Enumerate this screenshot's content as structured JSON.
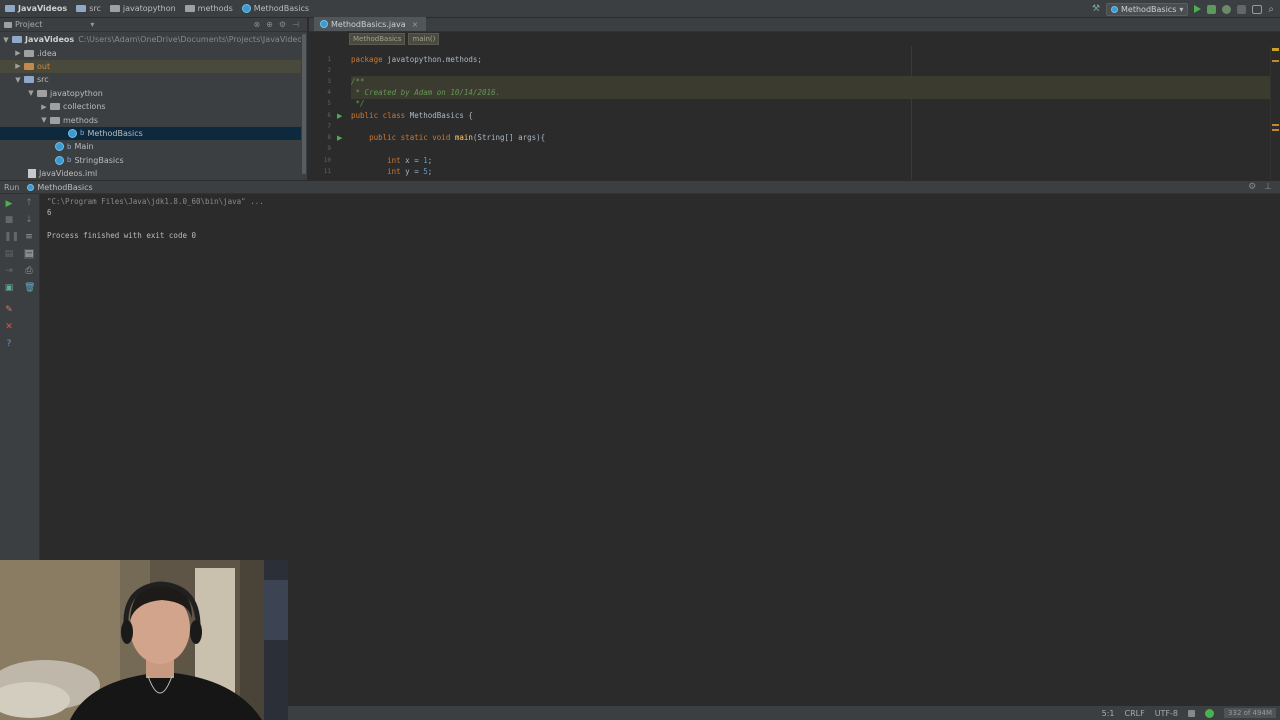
{
  "navbar": {
    "crumbs": [
      "JavaVideos",
      "src",
      "javatopython",
      "methods",
      "MethodBasics"
    ],
    "run_config": "MethodBasics"
  },
  "project": {
    "header": "Project",
    "root": {
      "label": "JavaVideos",
      "path": "C:\\Users\\Adam\\OneDrive\\Documents\\Projects\\JavaVideos"
    },
    "items": [
      {
        "label": ".idea"
      },
      {
        "label": "out"
      },
      {
        "label": "src"
      },
      {
        "label": "javatopython"
      },
      {
        "label": "collections"
      },
      {
        "label": "methods"
      },
      {
        "label": "MethodBasics"
      },
      {
        "label": "Main"
      },
      {
        "label": "StringBasics"
      },
      {
        "label": "JavaVideos.iml"
      }
    ]
  },
  "editor": {
    "tab": "MethodBasics.java",
    "crumbs": [
      "MethodBasics",
      "main()"
    ],
    "line_numbers": [
      "1",
      "2",
      "3",
      "4",
      "5",
      "6",
      "7",
      "8",
      "9",
      "10",
      "11"
    ],
    "code": {
      "l1_kw": "package",
      "l1_rest": " javatopython.methods;",
      "l3": "/**",
      "l4": " * Created by Adam on 10/14/2016.",
      "l5": " */",
      "l6_kw": "public class",
      "l6_rest": " MethodBasics {",
      "l8_kw": "public static void",
      "l8_fn": "main",
      "l8_rest": "(String[] args){",
      "l10_kw": "int",
      "l10_mid": " x = ",
      "l10_num": "1",
      "l11_kw": "int",
      "l11_mid": " y = ",
      "l11_num": "5"
    }
  },
  "run": {
    "label": "Run",
    "tab": "MethodBasics",
    "console": {
      "cmd": "\"C:\\Program Files\\Java\\jdk1.8.0_60\\bin\\java\" ...",
      "output": "6",
      "finished": "Process finished with exit code 0"
    }
  },
  "status": {
    "position": "5:1",
    "line_sep": "CRLF",
    "encoding": "UTF-8",
    "memory": "332 of 494M"
  },
  "colors": {
    "panel": "#3c3f41",
    "editor_bg": "#2b2b2b",
    "keyword": "#cc7832",
    "comment": "#629755",
    "number": "#6897bb",
    "selection": "#0d293e"
  }
}
